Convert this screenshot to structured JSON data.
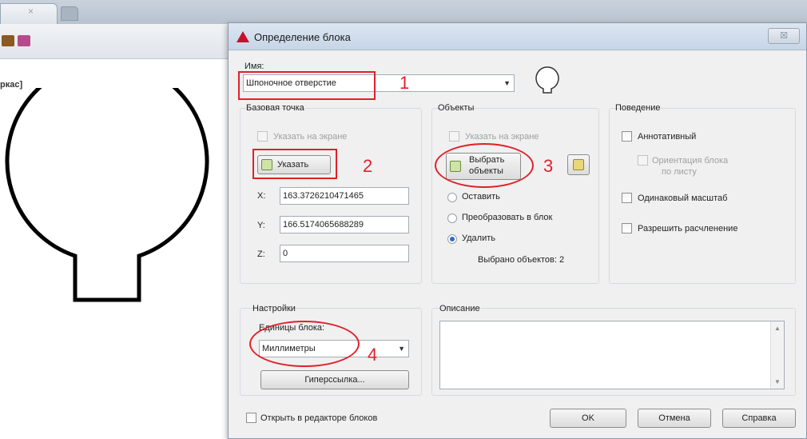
{
  "background_app": {
    "tab_close_glyph": "×",
    "drawing_label": "ркас]",
    "toolbar_icons": [
      "toolbar-icon-1",
      "toolbar-icon-2"
    ]
  },
  "dialog": {
    "title": "Определение блока",
    "close_glyph": "☒",
    "name_label": "Имя:",
    "name_value": "Шпоночное отверстие",
    "base_point": {
      "group_title": "Базовая точка",
      "pick_on_screen": "Указать на экране",
      "pick_button": "Указать",
      "x_label": "X:",
      "x_value": "163.3726210471465",
      "y_label": "Y:",
      "y_value": "166.5174065688289",
      "z_label": "Z:",
      "z_value": "0"
    },
    "objects": {
      "group_title": "Объекты",
      "pick_on_screen": "Указать на экране",
      "select_button_line1": "Выбрать",
      "select_button_line2": "объекты",
      "retain": "Оставить",
      "convert": "Преобразовать в блок",
      "delete": "Удалить",
      "selected_count": "Выбрано объектов: 2",
      "selected_radio": "delete"
    },
    "behavior": {
      "group_title": "Поведение",
      "annotative": "Аннотативный",
      "orientation_line1": "Ориентация блока",
      "orientation_line2": "по листу",
      "uniform_scale": "Одинаковый масштаб",
      "allow_explode": "Разрешить расчленение"
    },
    "settings": {
      "group_title": "Настройки",
      "units_label": "Единицы блока:",
      "units_value": "Миллиметры",
      "hyperlink_button": "Гиперссылка..."
    },
    "description": {
      "group_title": "Описание"
    },
    "open_in_editor": "Открыть в редакторе блоков",
    "ok": "OK",
    "cancel": "Отмена",
    "help": "Справка"
  },
  "annotations": [
    "1",
    "2",
    "3",
    "4"
  ],
  "colors": {
    "annotation": "#e0202a",
    "title_icon": "#c8102e"
  }
}
